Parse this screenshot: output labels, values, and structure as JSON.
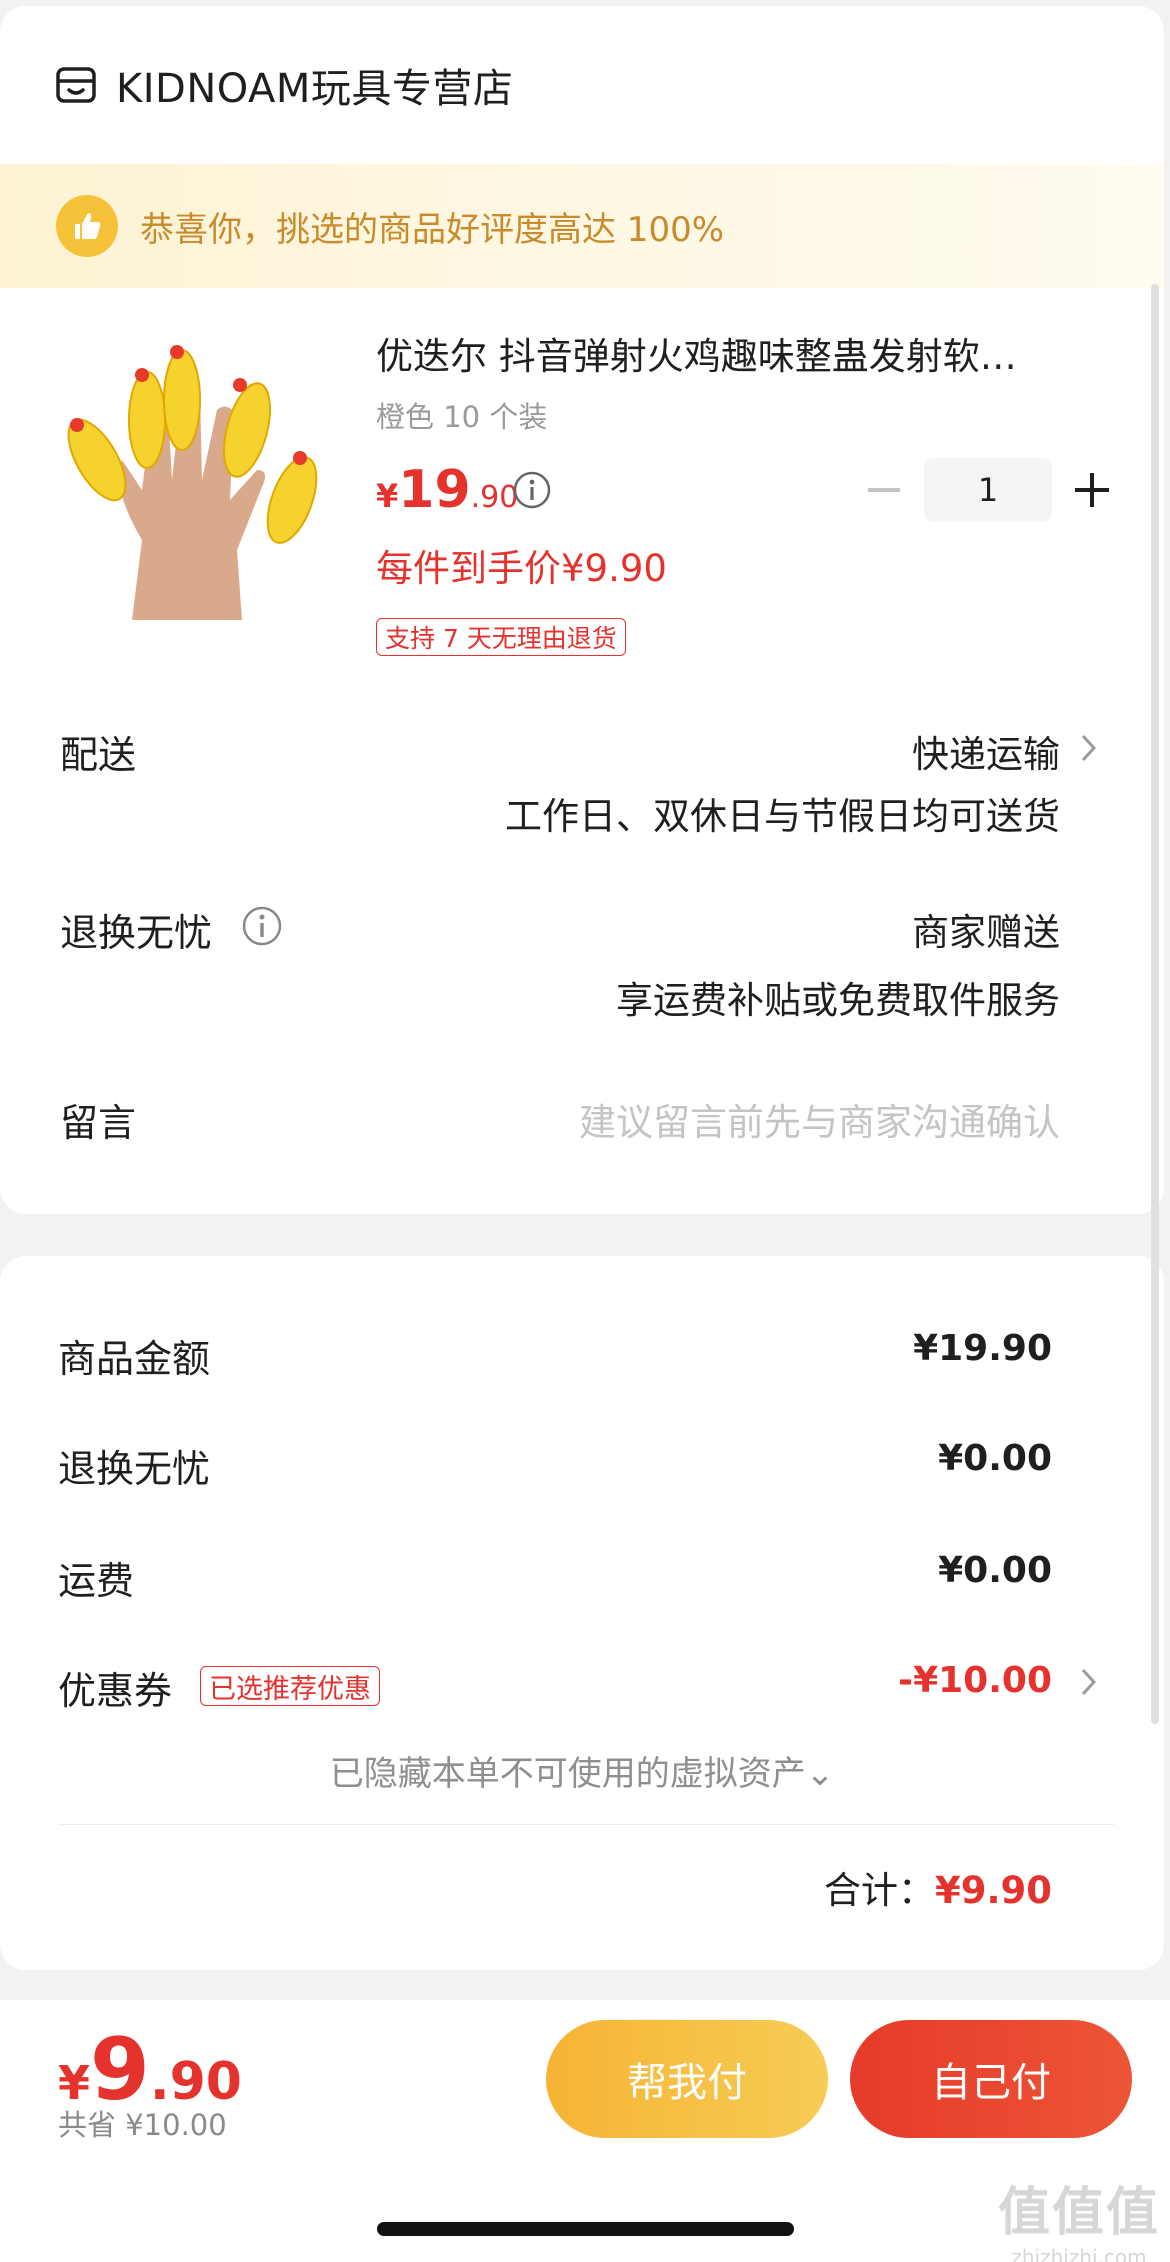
{
  "store": {
    "name": "KIDNOAM玩具专营店",
    "icon": "store-icon"
  },
  "banner": {
    "text": "恭喜你，挑选的商品好评度高达 100%",
    "icon": "thumbs-up-icon"
  },
  "product": {
    "title": "优迭尔 抖音弹射火鸡趣味整蛊发射软…",
    "spec": "橙色 10 个装",
    "price_currency": "¥",
    "price_int": "19",
    "price_dec": ".90",
    "unit_price": "每件到手价¥9.90",
    "return_tag": "支持 7 天无理由退货",
    "quantity": "1",
    "image": "rubber-chicken-finger-toys"
  },
  "delivery": {
    "label": "配送",
    "value": "快递运输",
    "sub": "工作日、双休日与节假日均可送货"
  },
  "worry_free": {
    "label": "退换无忧",
    "value": "商家赠送",
    "sub": "享运费补贴或免费取件服务"
  },
  "message": {
    "label": "留言",
    "placeholder": "建议留言前先与商家沟通确认"
  },
  "summary": {
    "goods_label": "商品金额",
    "goods_value": "¥19.90",
    "worry_label": "退换无忧",
    "worry_value": "¥0.00",
    "shipping_label": "运费",
    "shipping_value": "¥0.00",
    "coupon_label": "优惠券",
    "coupon_tag": "已选推荐优惠",
    "coupon_value": "-¥10.00",
    "hidden_assets": "已隐藏本单不可使用的虚拟资产⌄",
    "total_label": "合计：",
    "total_value": "¥9.90"
  },
  "footer": {
    "pay_currency": "¥",
    "pay_int": "9",
    "pay_dec": ".90",
    "saved": "共省 ¥10.00",
    "help_pay": "帮我付",
    "self_pay": "自己付"
  },
  "watermark": {
    "big": "值值值",
    "small": "zhizhizhi.com"
  },
  "colors": {
    "accent_red": "#e5322d",
    "banner_text": "#c98a2b",
    "help_button": "#f6c23a"
  }
}
